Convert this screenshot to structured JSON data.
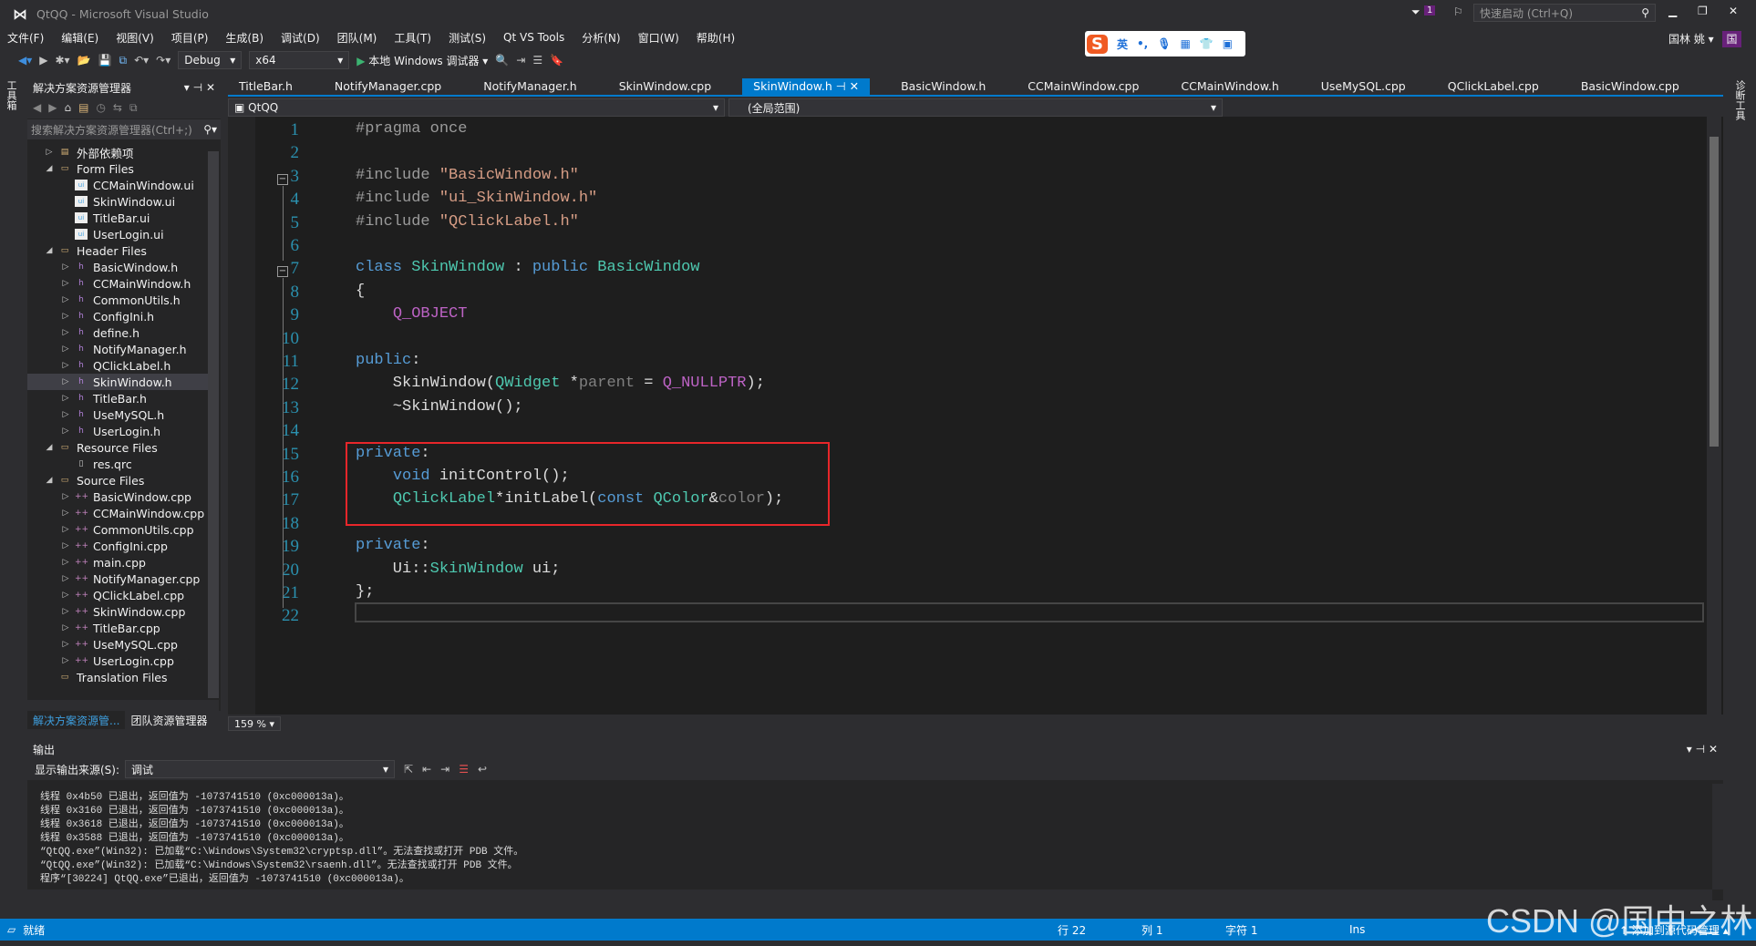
{
  "window": {
    "title": "QtQQ - Microsoft Visual Studio",
    "quick_launch_placeholder": "快速启动 (Ctrl+Q)",
    "notification_count": "1",
    "user": "国林 姚",
    "user_badge": "国"
  },
  "menu": [
    "文件(F)",
    "编辑(E)",
    "视图(V)",
    "项目(P)",
    "生成(B)",
    "调试(D)",
    "团队(M)",
    "工具(T)",
    "测试(S)",
    "Qt VS Tools",
    "分析(N)",
    "窗口(W)",
    "帮助(H)"
  ],
  "toolbar": {
    "config": "Debug",
    "platform": "x64",
    "run_label": "本地 Windows 调试器"
  },
  "ime": {
    "lang": "英"
  },
  "left_strip": {
    "label": "工具箱"
  },
  "right_strip": {
    "label": "诊断工具"
  },
  "solution_explorer": {
    "title": "解决方案资源管理器",
    "search_placeholder": "搜索解决方案资源管理器(Ctrl+;)",
    "items": [
      {
        "label": "外部依赖项",
        "level": 1,
        "arrow": "▷",
        "icon": "folder-ref"
      },
      {
        "label": "Form Files",
        "level": 1,
        "arrow": "◢",
        "icon": "filter"
      },
      {
        "label": "CCMainWindow.ui",
        "level": 2,
        "arrow": "",
        "icon": "ui"
      },
      {
        "label": "SkinWindow.ui",
        "level": 2,
        "arrow": "",
        "icon": "ui"
      },
      {
        "label": "TitleBar.ui",
        "level": 2,
        "arrow": "",
        "icon": "ui"
      },
      {
        "label": "UserLogin.ui",
        "level": 2,
        "arrow": "",
        "icon": "ui"
      },
      {
        "label": "Header Files",
        "level": 1,
        "arrow": "◢",
        "icon": "filter"
      },
      {
        "label": "BasicWindow.h",
        "level": 2,
        "arrow": "▷",
        "icon": "h"
      },
      {
        "label": "CCMainWindow.h",
        "level": 2,
        "arrow": "▷",
        "icon": "h"
      },
      {
        "label": "CommonUtils.h",
        "level": 2,
        "arrow": "▷",
        "icon": "h"
      },
      {
        "label": "ConfigIni.h",
        "level": 2,
        "arrow": "▷",
        "icon": "h"
      },
      {
        "label": "define.h",
        "level": 2,
        "arrow": "▷",
        "icon": "h"
      },
      {
        "label": "NotifyManager.h",
        "level": 2,
        "arrow": "▷",
        "icon": "h"
      },
      {
        "label": "QClickLabel.h",
        "level": 2,
        "arrow": "▷",
        "icon": "h"
      },
      {
        "label": "SkinWindow.h",
        "level": 2,
        "arrow": "▷",
        "icon": "h",
        "selected": true
      },
      {
        "label": "TitleBar.h",
        "level": 2,
        "arrow": "▷",
        "icon": "h"
      },
      {
        "label": "UseMySQL.h",
        "level": 2,
        "arrow": "▷",
        "icon": "h"
      },
      {
        "label": "UserLogin.h",
        "level": 2,
        "arrow": "▷",
        "icon": "h"
      },
      {
        "label": "Resource Files",
        "level": 1,
        "arrow": "◢",
        "icon": "filter"
      },
      {
        "label": "res.qrc",
        "level": 2,
        "arrow": "",
        "icon": "file"
      },
      {
        "label": "Source Files",
        "level": 1,
        "arrow": "◢",
        "icon": "filter"
      },
      {
        "label": "BasicWindow.cpp",
        "level": 2,
        "arrow": "▷",
        "icon": "cpp"
      },
      {
        "label": "CCMainWindow.cpp",
        "level": 2,
        "arrow": "▷",
        "icon": "cpp"
      },
      {
        "label": "CommonUtils.cpp",
        "level": 2,
        "arrow": "▷",
        "icon": "cpp"
      },
      {
        "label": "ConfigIni.cpp",
        "level": 2,
        "arrow": "▷",
        "icon": "cpp"
      },
      {
        "label": "main.cpp",
        "level": 2,
        "arrow": "▷",
        "icon": "cpp"
      },
      {
        "label": "NotifyManager.cpp",
        "level": 2,
        "arrow": "▷",
        "icon": "cpp"
      },
      {
        "label": "QClickLabel.cpp",
        "level": 2,
        "arrow": "▷",
        "icon": "cpp"
      },
      {
        "label": "SkinWindow.cpp",
        "level": 2,
        "arrow": "▷",
        "icon": "cpp"
      },
      {
        "label": "TitleBar.cpp",
        "level": 2,
        "arrow": "▷",
        "icon": "cpp"
      },
      {
        "label": "UseMySQL.cpp",
        "level": 2,
        "arrow": "▷",
        "icon": "cpp"
      },
      {
        "label": "UserLogin.cpp",
        "level": 2,
        "arrow": "▷",
        "icon": "cpp"
      },
      {
        "label": "Translation Files",
        "level": 1,
        "arrow": "",
        "icon": "filter"
      }
    ],
    "bottom_tabs": [
      "解决方案资源管...",
      "团队资源管理器"
    ]
  },
  "editor": {
    "tabs": [
      "TitleBar.h",
      "NotifyManager.cpp",
      "NotifyManager.h",
      "SkinWindow.cpp",
      "SkinWindow.h",
      "BasicWindow.h",
      "CCMainWindow.cpp",
      "CCMainWindow.h",
      "UseMySQL.cpp",
      "QClickLabel.cpp",
      "BasicWindow.cpp"
    ],
    "active_tab": "SkinWindow.h",
    "nav_project": "QtQQ",
    "nav_scope": "(全局范围)",
    "zoom": "159 %",
    "lines": [
      [
        [
          "#pragma once",
          "pre"
        ]
      ],
      [],
      [
        [
          "#include ",
          "pre"
        ],
        [
          "\"BasicWindow.h\"",
          "str"
        ]
      ],
      [
        [
          "#include ",
          "pre"
        ],
        [
          "\"ui_SkinWindow.h\"",
          "str"
        ]
      ],
      [
        [
          "#include ",
          "pre"
        ],
        [
          "\"QClickLabel.h\"",
          "str"
        ]
      ],
      [],
      [
        [
          "class ",
          "kw"
        ],
        [
          "SkinWindow",
          "type"
        ],
        [
          " : ",
          "plain"
        ],
        [
          "public ",
          "kw"
        ],
        [
          "BasicWindow",
          "type"
        ]
      ],
      [
        [
          "{",
          "plain"
        ]
      ],
      [
        [
          "    ",
          "plain"
        ],
        [
          "Q_OBJECT",
          "mac"
        ]
      ],
      [],
      [
        [
          "public",
          "kw"
        ],
        [
          ":",
          "plain"
        ]
      ],
      [
        [
          "    SkinWindow(",
          "plain"
        ],
        [
          "QWidget",
          "type"
        ],
        [
          " *",
          "plain"
        ],
        [
          "parent",
          "param"
        ],
        [
          " = ",
          "plain"
        ],
        [
          "Q_NULLPTR",
          "mac"
        ],
        [
          ");",
          "plain"
        ]
      ],
      [
        [
          "    ~SkinWindow();",
          "plain"
        ]
      ],
      [],
      [
        [
          "private",
          "kw"
        ],
        [
          ":",
          "plain"
        ]
      ],
      [
        [
          "    ",
          "plain"
        ],
        [
          "void ",
          "kw"
        ],
        [
          "initControl();",
          "plain"
        ]
      ],
      [
        [
          "    ",
          "plain"
        ],
        [
          "QClickLabel",
          "type"
        ],
        [
          "*initLabel(",
          "plain"
        ],
        [
          "const ",
          "kw"
        ],
        [
          "QColor",
          "type"
        ],
        [
          "&",
          "plain"
        ],
        [
          "color",
          "param"
        ],
        [
          ");",
          "plain"
        ]
      ],
      [],
      [
        [
          "private",
          "kw"
        ],
        [
          ":",
          "plain"
        ]
      ],
      [
        [
          "    Ui::",
          "plain"
        ],
        [
          "SkinWindow",
          "type"
        ],
        [
          " ui;",
          "plain"
        ]
      ],
      [
        [
          "};",
          "plain"
        ]
      ],
      []
    ],
    "highlight_box_color": "#e8262a"
  },
  "output": {
    "title": "输出",
    "source_label": "显示输出来源(S):",
    "source_value": "调试",
    "lines": [
      "线程 0x4b50 已退出，返回值为 -1073741510 (0xc000013a)。",
      "线程 0x3160 已退出，返回值为 -1073741510 (0xc000013a)。",
      "线程 0x3618 已退出，返回值为 -1073741510 (0xc000013a)。",
      "线程 0x3588 已退出，返回值为 -1073741510 (0xc000013a)。",
      "“QtQQ.exe”(Win32): 已加载“C:\\Windows\\System32\\cryptsp.dll”。无法查找或打开 PDB 文件。",
      "“QtQQ.exe”(Win32): 已加载“C:\\Windows\\System32\\rsaenh.dll”。无法查找或打开 PDB 文件。",
      "程序“[30224] QtQQ.exe”已退出，返回值为 -1073741510 (0xc000013a)。"
    ]
  },
  "status": {
    "ready": "就绪",
    "line": "行 22",
    "col": "列 1",
    "char": "字符 1",
    "mode": "Ins",
    "source_control": "添加到源代码管理"
  },
  "watermark": "CSDN @国中之林",
  "colors": {
    "accent": "#007acc",
    "editor_bg": "#1e1e1e",
    "chrome_bg": "#2d2d30"
  }
}
